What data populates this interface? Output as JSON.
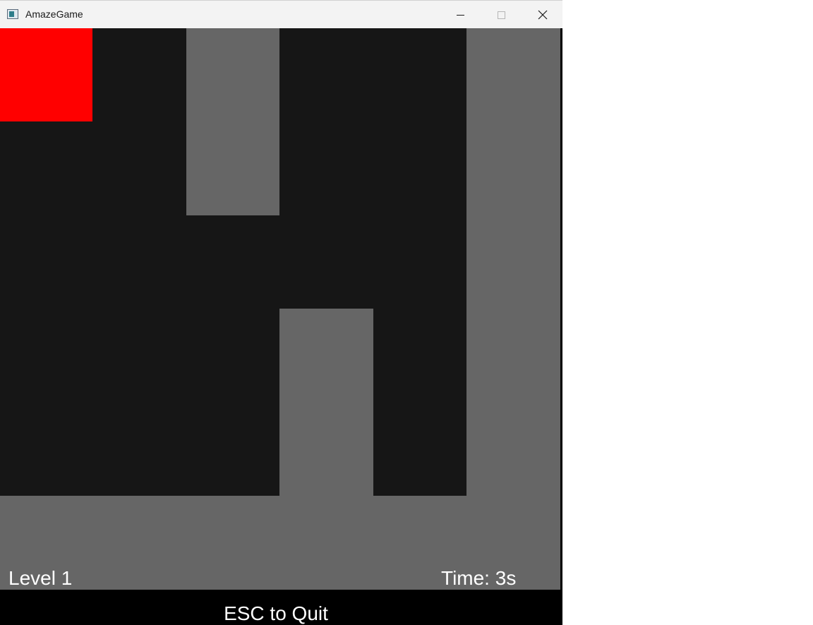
{
  "window": {
    "title": "AmazeGame",
    "app_icon": "window-app-icon",
    "controls": {
      "minimize_icon": "minimize-icon",
      "maximize_icon": "maximize-icon",
      "close_icon": "close-icon"
    }
  },
  "game": {
    "colors": {
      "floor": "#161616",
      "wall": "#666666",
      "player": "#ff0000",
      "hud_text": "#ffffff",
      "footer": "#000000"
    },
    "hud": {
      "level": "Level 1",
      "time": "Time: 3s"
    },
    "footer_text": "ESC to Quit"
  }
}
